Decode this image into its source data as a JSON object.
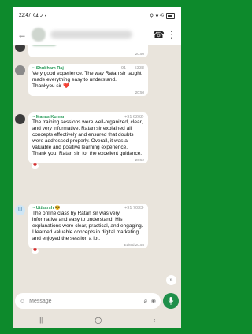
{
  "status": {
    "time": "22:47",
    "left_extra": "94 ✓ •",
    "right_icons": "⚲ ▼⁴ᴳ"
  },
  "header": {
    "back": "←",
    "call": "☎",
    "menu": "⋮"
  },
  "messages": [
    {
      "sender": "",
      "phone": "",
      "text": "",
      "time": "20:50"
    },
    {
      "sender": "~ Shubham Raj",
      "phone": "+91 ·····5338",
      "text": "Very good experience. The way Ratan sir taught made everything easy to understand.\nThankyou sir ❤️",
      "time": "20:50"
    },
    {
      "sender": "~ Manas Kumar",
      "phone": "+91 6202·",
      "text": "The training sessions were well-organized, clear, and very informative. Ratan sir explained all concepts effectively and ensured that doubts were addressed properly. Overall, it was a valuable and positive learning experience.\nThank you, Ratan sir, for the excellent guidance.",
      "time": "20:52"
    },
    {
      "sender": "~ Uttkarsh 😎",
      "phone": "+91 7033·",
      "text": "The online class by Ratan sir was very informative and easy to understand. His explanations were clear, practical, and engaging. I learned valuable concepts in digital marketing and enjoyed the session a lot.",
      "time": "Edited 20:55"
    }
  ],
  "reaction": "❤",
  "input": {
    "placeholder": "Message"
  },
  "avatar_letter": "U",
  "nav": {
    "recent": "|||",
    "home": "◯",
    "back": "‹"
  },
  "scroll": "»"
}
